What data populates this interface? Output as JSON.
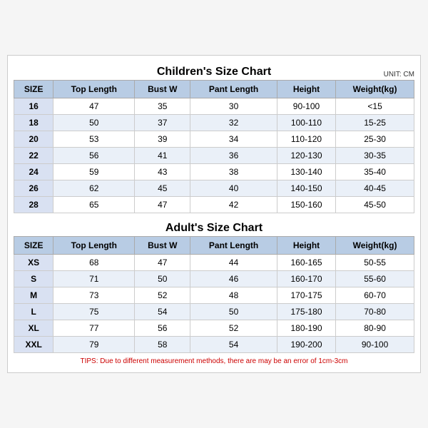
{
  "children_title": "Children's Size Chart",
  "adult_title": "Adult's Size Chart",
  "unit": "UNIT: CM",
  "children_headers": [
    "SIZE",
    "Top Length",
    "Bust W",
    "Pant Length",
    "Height",
    "Weight(kg)"
  ],
  "children_rows": [
    [
      "16",
      "47",
      "35",
      "30",
      "90-100",
      "<15"
    ],
    [
      "18",
      "50",
      "37",
      "32",
      "100-110",
      "15-25"
    ],
    [
      "20",
      "53",
      "39",
      "34",
      "110-120",
      "25-30"
    ],
    [
      "22",
      "56",
      "41",
      "36",
      "120-130",
      "30-35"
    ],
    [
      "24",
      "59",
      "43",
      "38",
      "130-140",
      "35-40"
    ],
    [
      "26",
      "62",
      "45",
      "40",
      "140-150",
      "40-45"
    ],
    [
      "28",
      "65",
      "47",
      "42",
      "150-160",
      "45-50"
    ]
  ],
  "adult_headers": [
    "SIZE",
    "Top Length",
    "Bust W",
    "Pant Length",
    "Height",
    "Weight(kg)"
  ],
  "adult_rows": [
    [
      "XS",
      "68",
      "47",
      "44",
      "160-165",
      "50-55"
    ],
    [
      "S",
      "71",
      "50",
      "46",
      "160-170",
      "55-60"
    ],
    [
      "M",
      "73",
      "52",
      "48",
      "170-175",
      "60-70"
    ],
    [
      "L",
      "75",
      "54",
      "50",
      "175-180",
      "70-80"
    ],
    [
      "XL",
      "77",
      "56",
      "52",
      "180-190",
      "80-90"
    ],
    [
      "XXL",
      "79",
      "58",
      "54",
      "190-200",
      "90-100"
    ]
  ],
  "tips": "TIPS: Due to different measurement methods, there are may be an error of 1cm-3cm"
}
